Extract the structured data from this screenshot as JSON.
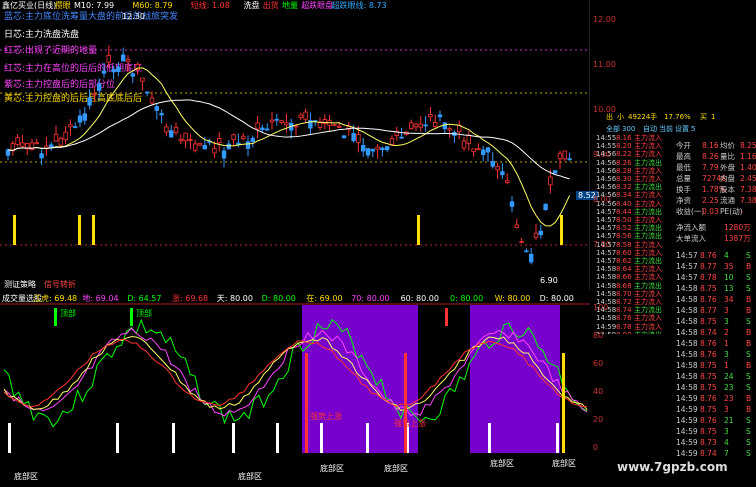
{
  "main": {
    "header": [
      {
        "text": "鑫亿买业(日线)",
        "color": "#ffffff"
      },
      {
        "text": "攒眼",
        "color": "#ffdd00"
      },
      {
        "text": "M10: 7.99",
        "color": "#ffffff"
      },
      {
        "text": "M60: 8.79",
        "color": "#ffdd00"
      },
      {
        "text": "短线: 1.08",
        "color": "#ff3333"
      },
      {
        "text": "洗盘",
        "color": "#ffffff"
      },
      {
        "text": "出货",
        "color": "#ff3333"
      },
      {
        "text": "地量",
        "color": "#00ff00"
      },
      {
        "text": "超跌眼盘",
        "color": "#ff44ff"
      },
      {
        "text": "超跌眼线: 8.73",
        "color": "#33aaff"
      }
    ],
    "legend": [
      {
        "text": "蓝芯:主力底位洗筹量大盘的前后的战旅突发",
        "color": "#4488ff"
      },
      {
        "text": "日芯:主力洗盘洗盘",
        "color": "#ffffff"
      },
      {
        "text": "红芯:出现了近期的地量",
        "color": "#ff44ff"
      },
      {
        "text": "红芯:主力在高位的后后的低期底底",
        "color": "#ff44ff"
      },
      {
        "text": "紫芯:主力控盘后的后部分位",
        "color": "#ff44ff"
      },
      {
        "text": "黄芯:主力控盘的后后且高底底后后",
        "color": "#ffdd00"
      }
    ],
    "price_high": "12.30",
    "price_low": "6.90",
    "price_now": "8.52",
    "bottom_labels": [
      {
        "text": "测证策略",
        "color": "#ffffff"
      },
      {
        "text": "信号转折",
        "color": "#ff4444"
      }
    ],
    "axis_labels": [
      "12.00",
      "11.00",
      "10.00",
      "9.00",
      "8.00",
      "7.00"
    ]
  },
  "indicator": {
    "header": [
      {
        "text": "成交量选股",
        "color": "#ffffff"
      },
      {
        "text": "江虎: 69.48",
        "color": "#ffdd00"
      },
      {
        "text": "地: 69.04",
        "color": "#ff44ff"
      },
      {
        "text": "D: 64.57",
        "color": "#00ff00"
      },
      {
        "text": "涨: 69.68",
        "color": "#ff3333"
      },
      {
        "text": "天: 80.00",
        "color": "#ffffff"
      },
      {
        "text": "D: 80.00",
        "color": "#00ff00"
      },
      {
        "text": "在: 69.00",
        "color": "#ffdd00"
      },
      {
        "text": "70: 80.00",
        "color": "#ff44ff"
      },
      {
        "text": "60: 80.00",
        "color": "#ffffff"
      },
      {
        "text": "0: 80.00",
        "color": "#00ff00"
      },
      {
        "text": "W: 80.00",
        "color": "#ffdd00"
      },
      {
        "text": "D: 80.00",
        "color": "#ffffff"
      }
    ],
    "tags": [
      {
        "text": "底部区",
        "color": "#ffffff"
      },
      {
        "text": "底部区",
        "color": "#ffffff"
      },
      {
        "text": "底部区",
        "color": "#ffffff"
      },
      {
        "text": "底部区",
        "color": "#ffffff"
      },
      {
        "text": "底部区",
        "color": "#ffffff"
      },
      {
        "text": "底部区",
        "color": "#ffffff"
      },
      {
        "text": "强势上涨",
        "color": "#ff3333"
      },
      {
        "text": "强势上涨",
        "color": "#ff3333"
      },
      {
        "text": "顶部",
        "color": "#00ff00"
      },
      {
        "text": "顶部",
        "color": "#00ff00"
      }
    ],
    "axis_labels": [
      "100",
      "80",
      "60",
      "40",
      "20",
      "0"
    ]
  },
  "side": {
    "head": [
      "出",
      "小",
      "49224手",
      "17.76%",
      "买",
      "1",
      "全部",
      "300",
      "自动",
      "当前",
      "设置",
      "5"
    ],
    "tape": [
      [
        "14:55",
        "8.16",
        "主力流入",
        "1"
      ],
      [
        "14:55",
        "8.20",
        "主力流入",
        "2"
      ],
      [
        "14:56",
        "8.22",
        "主力流入",
        "3"
      ],
      [
        "14:56",
        "8.26",
        "主力流出",
        "4"
      ],
      [
        "14:56",
        "8.28",
        "主力流入",
        "5"
      ],
      [
        "14:56",
        "8.30",
        "主力流入",
        "6"
      ],
      [
        "14:56",
        "8.32",
        "主力流出",
        "7"
      ],
      [
        "14:56",
        "8.34",
        "主力流入",
        "8"
      ],
      [
        "14:56",
        "8.40",
        "主力流入",
        "9"
      ],
      [
        "14:57",
        "8.44",
        "主力流出",
        "10"
      ],
      [
        "14:57",
        "8.50",
        "主力流入",
        "11"
      ],
      [
        "14:57",
        "8.52",
        "主力流出",
        "12"
      ],
      [
        "14:57",
        "8.56",
        "主力流出",
        "13"
      ],
      [
        "14:57",
        "8.58",
        "主力流入",
        "14"
      ],
      [
        "14:57",
        "8.60",
        "主力流入",
        "15"
      ],
      [
        "14:57",
        "8.62",
        "主力流出",
        "16"
      ],
      [
        "14:58",
        "8.64",
        "主力流入",
        "17"
      ],
      [
        "14:58",
        "8.66",
        "主力流入",
        "18"
      ],
      [
        "14:58",
        "8.68",
        "主力流出",
        "19"
      ],
      [
        "14:58",
        "8.70",
        "主力流入",
        "20"
      ],
      [
        "14:58",
        "8.72",
        "主力流入",
        "21"
      ],
      [
        "14:58",
        "8.74",
        "主力流出",
        "22"
      ],
      [
        "14:58",
        "8.76",
        "主力流入",
        "23"
      ],
      [
        "14:59",
        "8.78",
        "主力流入",
        "24"
      ],
      [
        "14:59",
        "8.80",
        "主力流出",
        "25"
      ]
    ],
    "quote": [
      [
        "今开",
        "8.16",
        "均价",
        "8.25"
      ],
      [
        "最高",
        "8.26",
        "量比",
        "1.16"
      ],
      [
        "最低",
        "7.79",
        "外盘",
        "1.40"
      ],
      [
        "总量",
        "72746",
        "内盘",
        "2.45"
      ],
      [
        "换手",
        "1.78%",
        "股本",
        "7.38亿"
      ],
      [
        "净资",
        "2.25",
        "流通",
        "7.38亿"
      ],
      [
        "收益(一)",
        "0.03",
        "PE(动)",
        "-"
      ]
    ],
    "flow": [
      [
        "净流入额",
        "1280万"
      ],
      [
        "大单流入",
        "1387万"
      ]
    ],
    "ticks": [
      [
        "14:57",
        "8.76",
        "4",
        "S"
      ],
      [
        "14:57",
        "8.77",
        "35",
        "B"
      ],
      [
        "14:57",
        "8.78",
        "10",
        "S"
      ],
      [
        "14:58",
        "8.75",
        "13",
        "S"
      ],
      [
        "14:58",
        "8.76",
        "34",
        "B"
      ],
      [
        "14:58",
        "8.77",
        "3",
        "B"
      ],
      [
        "14:58",
        "8.75",
        "3",
        "S"
      ],
      [
        "14:58",
        "8.74",
        "2",
        "B"
      ],
      [
        "14:58",
        "8.76",
        "1",
        "B"
      ],
      [
        "14:58",
        "8.76",
        "3",
        "S"
      ],
      [
        "14:58",
        "8.75",
        "1",
        "B"
      ],
      [
        "14:58",
        "8.75",
        "24",
        "S"
      ],
      [
        "14:58",
        "8.75",
        "23",
        "S"
      ],
      [
        "14:59",
        "8.76",
        "23",
        "B"
      ],
      [
        "14:59",
        "8.75",
        "3",
        "B"
      ],
      [
        "14:59",
        "8.76",
        "21",
        "S"
      ],
      [
        "14:59",
        "8.75",
        "3",
        "S"
      ],
      [
        "14:59",
        "8.73",
        "4",
        "S"
      ],
      [
        "14:59",
        "8.74",
        "7",
        "S"
      ]
    ]
  },
  "watermark": "www.7gpzb.com"
}
